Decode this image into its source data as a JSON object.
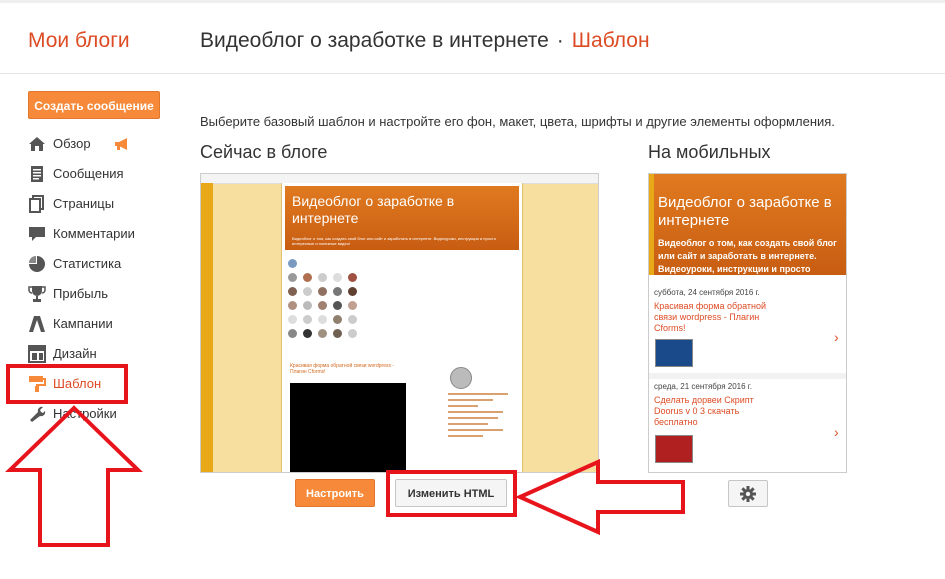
{
  "header": {
    "brand": "Мои блоги",
    "blog_title": "Видеоблог о заработке в интернете",
    "separator": "·",
    "section": "Шаблон"
  },
  "sidebar": {
    "create_button": "Создать сообщение",
    "items": [
      {
        "label": "Обзор",
        "icon": "home-icon"
      },
      {
        "label": "Сообщения",
        "icon": "posts-icon"
      },
      {
        "label": "Страницы",
        "icon": "pages-icon"
      },
      {
        "label": "Комментарии",
        "icon": "comments-icon"
      },
      {
        "label": "Статистика",
        "icon": "stats-icon"
      },
      {
        "label": "Прибыль",
        "icon": "trophy-icon"
      },
      {
        "label": "Кампании",
        "icon": "campaigns-icon"
      },
      {
        "label": "Дизайн",
        "icon": "layout-icon"
      },
      {
        "label": "Шаблон",
        "icon": "paint-roller-icon",
        "active": true
      },
      {
        "label": "Настройки",
        "icon": "wrench-icon"
      }
    ]
  },
  "main": {
    "description": "Выберите базовый шаблон и настройте его фон, макет, цвета, шрифты и другие элементы оформления.",
    "current_heading": "Сейчас в блоге",
    "mobile_heading": "На мобильных",
    "customize_button": "Настроить",
    "edit_html_button": "Изменить HTML"
  },
  "preview": {
    "title": "Видеоблог о заработке в интернете",
    "subtitle": "Видеоблог о том, как создать свой блог или сайт и заработать в интернете. Видеоуроки, инструкции и просто интересные и полезные видео!",
    "post_title": "Красивая форма обратной связи wordpress - Плагин Cforms!"
  },
  "mobile_preview": {
    "title": "Видеоблог о заработке в интернете",
    "subtitle": "Видеоблог о том, как создать свой блог или сайт и заработать в интернете. Видеоуроки, инструкции и просто интересные и полезные видео!",
    "posts": [
      {
        "date": "суббота, 24 сентября 2016 г.",
        "title": "Красивая форма обратной связи wordpress - Плагин Cforms!"
      },
      {
        "date": "среда, 21 сентября 2016 г.",
        "title": "Сделать дорвеи Скрипт Doorus v 0 3 скачать бесплатно"
      }
    ],
    "arrow": "›"
  },
  "colors": {
    "accent": "#dd4b24",
    "button_orange": "#f68a3a",
    "annotation_red": "#e8141c"
  }
}
